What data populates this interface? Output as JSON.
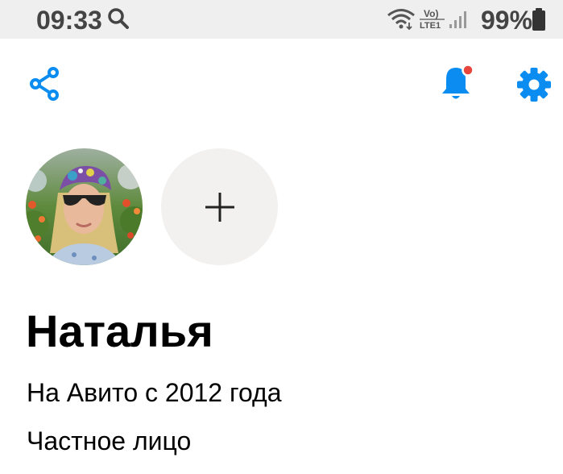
{
  "status_bar": {
    "time": "09:33",
    "network": "Vo) LTE1",
    "battery_percent": "99%"
  },
  "toolbar": {
    "share_icon": "share-icon",
    "notifications_icon": "bell-icon",
    "notifications_badge_color": "#e8453c",
    "settings_icon": "gear-icon",
    "accent_color": "#0a8cf0"
  },
  "profile": {
    "name": "Наталья",
    "member_since": "На Авито с 2012 года",
    "account_type": "Частное лицо",
    "avatar_icon": "avatar-photo",
    "add_photo_icon": "plus-icon"
  }
}
